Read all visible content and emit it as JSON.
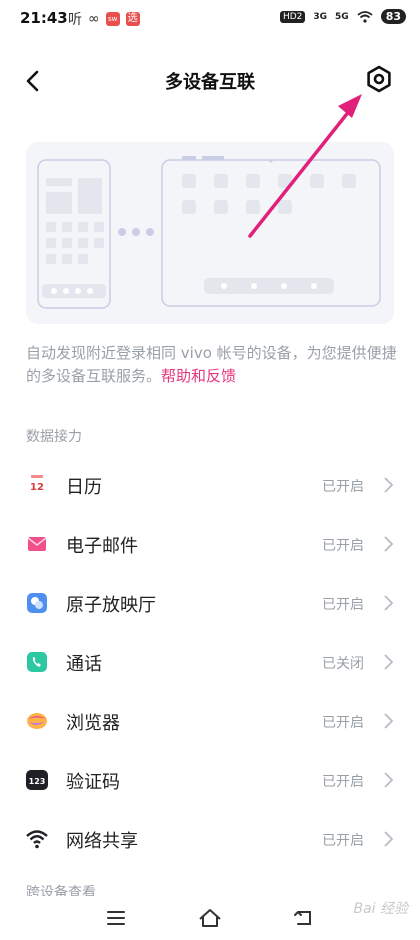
{
  "status_bar": {
    "time": "21:43",
    "left_text": "听",
    "link_glyph": "∞",
    "badge1": "sw",
    "badge2": "选",
    "hd": "HD2",
    "net1": "3G",
    "net2": "5G",
    "battery": "83"
  },
  "header": {
    "title": "多设备互联"
  },
  "description": {
    "text": "自动发现附近登录相同 vivo 帐号的设备，为您提供便捷的多设备互联服务。",
    "link": "帮助和反馈"
  },
  "section_label": "数据接力",
  "items": [
    {
      "name": "日历",
      "state": "已开启",
      "icon": "calendar-icon",
      "icon_text": "12"
    },
    {
      "name": "电子邮件",
      "state": "已开启",
      "icon": "email-icon"
    },
    {
      "name": "原子放映厅",
      "state": "已开启",
      "icon": "theater-icon"
    },
    {
      "name": "通话",
      "state": "已关闭",
      "icon": "call-icon"
    },
    {
      "name": "浏览器",
      "state": "已开启",
      "icon": "browser-icon"
    },
    {
      "name": "验证码",
      "state": "已开启",
      "icon": "verification-code-icon",
      "icon_text": "123"
    },
    {
      "name": "网络共享",
      "state": "已开启",
      "icon": "wifi-share-icon"
    }
  ],
  "partial_section": "跨设备查看",
  "watermark": "Bai 经验",
  "colors": {
    "accent": "#e5367c",
    "arrow": "#e0207a"
  }
}
